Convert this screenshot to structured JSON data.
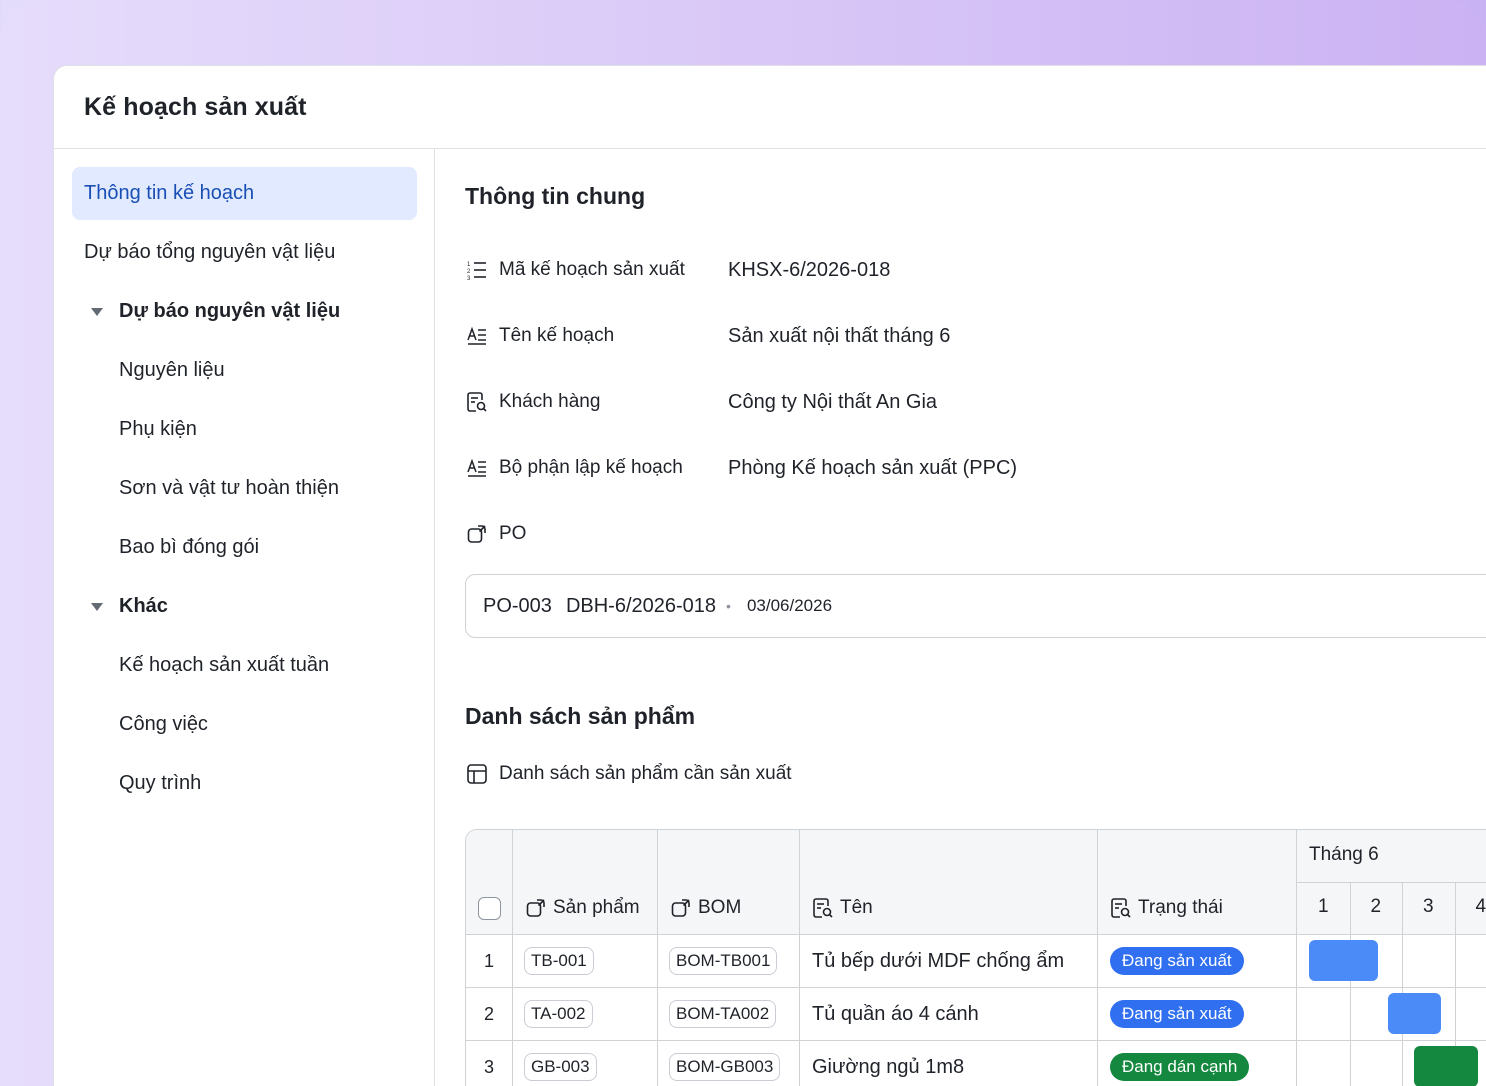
{
  "app": {
    "title": "Kế hoạch sản xuất"
  },
  "sidebar": {
    "items": [
      {
        "label": "Thông tin kế hoạch",
        "active": true,
        "kind": "item"
      },
      {
        "label": "Dự báo tổng nguyên vật liệu",
        "kind": "item"
      },
      {
        "label": "Dự báo nguyên vật liệu",
        "kind": "group",
        "expanded": true
      },
      {
        "label": "Nguyên liệu",
        "kind": "child"
      },
      {
        "label": "Phụ kiện",
        "kind": "child"
      },
      {
        "label": "Sơn và vật tư hoàn thiện",
        "kind": "child"
      },
      {
        "label": "Bao bì đóng gói",
        "kind": "child"
      },
      {
        "label": "Khác",
        "kind": "group",
        "expanded": true
      },
      {
        "label": "Kế hoạch sản xuất tuần",
        "kind": "child"
      },
      {
        "label": "Công việc",
        "kind": "child"
      },
      {
        "label": "Quy trình",
        "kind": "child"
      }
    ]
  },
  "general": {
    "title": "Thông tin chung",
    "fields": [
      {
        "icon": "list-icon",
        "label": "Mã kế hoạch sản xuất",
        "value": "KHSX-6/2026-018"
      },
      {
        "icon": "text-icon",
        "label": "Tên kế hoạch",
        "value": "Sản xuất nội thất tháng 6"
      },
      {
        "icon": "lookup-icon",
        "label": "Khách hàng",
        "value": "Công ty Nội thất An Gia"
      },
      {
        "icon": "text-icon",
        "label": "Bộ phận lập kế hoạch",
        "value": "Phòng Kế hoạch sản xuất (PPC)"
      },
      {
        "icon": "link-icon",
        "label": "PO",
        "value": ""
      }
    ],
    "po": {
      "code": "PO-003",
      "ref": "DBH-6/2026-018",
      "separator": "•",
      "date": "03/06/2026"
    }
  },
  "products": {
    "title": "Danh sách sản phẩm",
    "table_label": "Danh sách sản phẩm cần sản xuất",
    "columns": {
      "product": "Sản phẩm",
      "bom": "BOM",
      "name": "Tên",
      "status": "Trạng thái"
    },
    "month": "Tháng 6",
    "days": [
      "1",
      "2",
      "3",
      "4"
    ],
    "rows": [
      {
        "no": "1",
        "product": "TB-001",
        "bom": "BOM-TB001",
        "name": "Tủ bếp dưới MDF chống ẩm",
        "status": "Đang sản xuất",
        "status_color": "#2f6ff0",
        "bar_color": "#4b8bf7",
        "bar_start_day": 1,
        "bar_end_day": 2.3
      },
      {
        "no": "2",
        "product": "TA-002",
        "bom": "BOM-TA002",
        "name": "Tủ quần áo 4 cánh",
        "status": "Đang sản xuất",
        "status_color": "#2f6ff0",
        "bar_color": "#4b8bf7",
        "bar_start_day": 2.5,
        "bar_end_day": 3.5
      },
      {
        "no": "3",
        "product": "GB-003",
        "bom": "BOM-GB003",
        "name": "Giường ngủ 1m8",
        "status": "Đang dán cạnh",
        "status_color": "#14883e",
        "bar_color": "#14883e",
        "bar_start_day": 3,
        "bar_end_day": 4.2
      }
    ]
  },
  "colors": {
    "active_bg": "#e1eaff",
    "active_text": "#1a4fb5"
  }
}
